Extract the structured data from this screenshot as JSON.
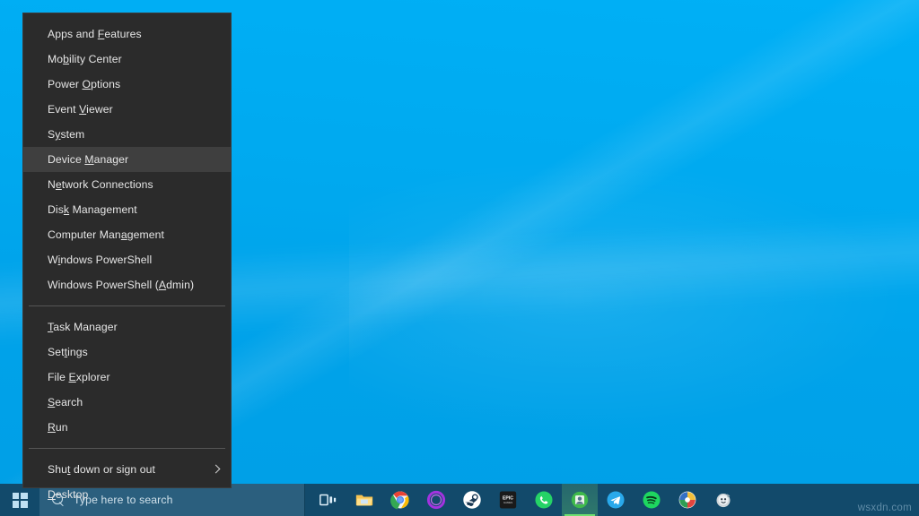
{
  "desktop": {
    "wallpaper_color": "#00a8ef",
    "wallpaper_color_dark": "#009fe6"
  },
  "winx_menu": {
    "name": "Win+X Power User Menu",
    "background_color": "#2b2b2b",
    "selected_item": "Device Manager",
    "selected_background": "#3f3f3f",
    "groups": [
      {
        "items": [
          {
            "label": "Apps and Features",
            "accel_index": 9,
            "submenu": false
          },
          {
            "label": "Mobility Center",
            "accel_index": 2,
            "submenu": false
          },
          {
            "label": "Power Options",
            "accel_index": 6,
            "submenu": false
          },
          {
            "label": "Event Viewer",
            "accel_index": 6,
            "submenu": false
          },
          {
            "label": "System",
            "accel_index": 1,
            "submenu": false
          },
          {
            "label": "Device Manager",
            "accel_index": 7,
            "submenu": false,
            "selected": true
          },
          {
            "label": "Network Connections",
            "accel_index": 1,
            "submenu": false
          },
          {
            "label": "Disk Management",
            "accel_index": 3,
            "submenu": false
          },
          {
            "label": "Computer Management",
            "accel_index": 12,
            "submenu": false
          },
          {
            "label": "Windows PowerShell",
            "accel_index": 1,
            "submenu": false
          },
          {
            "label": "Windows PowerShell (Admin)",
            "accel_index": 20,
            "submenu": false
          }
        ]
      },
      {
        "items": [
          {
            "label": "Task Manager",
            "accel_index": 0,
            "submenu": false
          },
          {
            "label": "Settings",
            "accel_index": 3,
            "submenu": false
          },
          {
            "label": "File Explorer",
            "accel_index": 5,
            "submenu": false
          },
          {
            "label": "Search",
            "accel_index": 0,
            "submenu": false
          },
          {
            "label": "Run",
            "accel_index": 0,
            "submenu": false
          }
        ]
      },
      {
        "items": [
          {
            "label": "Shut down or sign out",
            "accel_index": 3,
            "submenu": true
          },
          {
            "label": "Desktop",
            "accel_index": 0,
            "submenu": false
          }
        ]
      }
    ]
  },
  "taskbar": {
    "background_color": "#124a6b",
    "start_button": {
      "label": "Start",
      "icon": "windows-logo-icon"
    },
    "search": {
      "placeholder": "Type here to search",
      "value": "",
      "icon": "search-icon",
      "background_color": "#2b5f7e"
    },
    "apps": [
      {
        "name": "task-view",
        "title": "Task View",
        "active": false
      },
      {
        "name": "file-explorer",
        "title": "File Explorer",
        "active": false
      },
      {
        "name": "google-chrome",
        "title": "Google Chrome",
        "active": false
      },
      {
        "name": "purple-ring-app",
        "title": "Purple Ring App",
        "active": false
      },
      {
        "name": "steam",
        "title": "Steam",
        "active": false
      },
      {
        "name": "epic-games",
        "title": "Epic Games Launcher",
        "active": false
      },
      {
        "name": "whatsapp",
        "title": "WhatsApp",
        "active": false
      },
      {
        "name": "green-active-app",
        "title": "Active App",
        "active": true
      },
      {
        "name": "telegram",
        "title": "Telegram",
        "active": false
      },
      {
        "name": "spotify",
        "title": "Spotify",
        "active": false
      },
      {
        "name": "colorful-circle-app",
        "title": "Colorful Circle App",
        "active": false
      },
      {
        "name": "grey-mascot-app",
        "title": "Mascot App",
        "active": false
      }
    ],
    "watermark": "wsxdn.com"
  }
}
